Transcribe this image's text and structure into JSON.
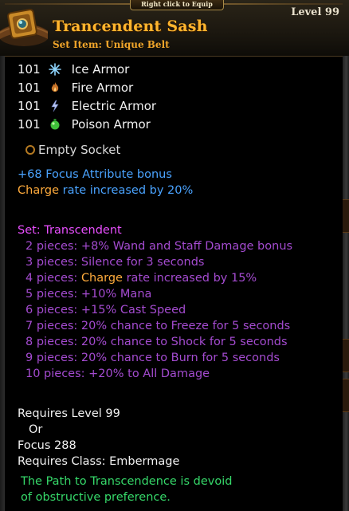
{
  "header": {
    "equip_hint": "Right click to Equip",
    "title": "Trancendent Sash",
    "subtitle": "Set Item: Unique Belt",
    "level": "Level 99"
  },
  "resists": [
    {
      "value": "101",
      "label": "Ice Armor",
      "icon": "snowflake-icon"
    },
    {
      "value": "101",
      "label": "Fire Armor",
      "icon": "flame-icon"
    },
    {
      "value": "101",
      "label": "Electric Armor",
      "icon": "lightning-icon"
    },
    {
      "value": "101",
      "label": "Poison Armor",
      "icon": "poison-icon"
    }
  ],
  "socket": {
    "label": "Empty Socket"
  },
  "bonuses": {
    "focus_bonus": "+68 Focus Attribute bonus",
    "charge_prefix": "Charge",
    "charge_rest": " rate increased by 20%"
  },
  "set": {
    "title": "Set: Transcendent",
    "pieces": [
      {
        "prefix": "2 pieces: +8% Wand and Staff Damage bonus",
        "highlight": "",
        "suffix": ""
      },
      {
        "prefix": "3 pieces: Silence for 3 seconds",
        "highlight": "",
        "suffix": ""
      },
      {
        "prefix": "4 pieces: ",
        "highlight": "Charge",
        "suffix": " rate increased by 15%"
      },
      {
        "prefix": "5 pieces: +10% Mana",
        "highlight": "",
        "suffix": ""
      },
      {
        "prefix": "6 pieces: +15% Cast Speed",
        "highlight": "",
        "suffix": ""
      },
      {
        "prefix": "7 pieces: 20% chance to Freeze for 5 seconds",
        "highlight": "",
        "suffix": ""
      },
      {
        "prefix": "8 pieces: 20% chance to Shock for 5 seconds",
        "highlight": "",
        "suffix": ""
      },
      {
        "prefix": "9 pieces: 20% chance to Burn for 5 seconds",
        "highlight": "",
        "suffix": ""
      },
      {
        "prefix": "10 pieces: +20% to All Damage",
        "highlight": "",
        "suffix": ""
      }
    ]
  },
  "requirements": {
    "level": "Requires Level 99",
    "or": "Or",
    "focus": "Focus 288",
    "class": "Requires Class: Embermage"
  },
  "flavor": {
    "line1": "The Path to Transcendence is devoid",
    "line2": "of obstructive preference."
  },
  "colors": {
    "title": "#ffb52e",
    "blue_bonus": "#4aa3ff",
    "charge": "#ffab3c",
    "set_title": "#e94fff",
    "set_pieces": "#a44bd0",
    "flavor": "#36d96a"
  }
}
